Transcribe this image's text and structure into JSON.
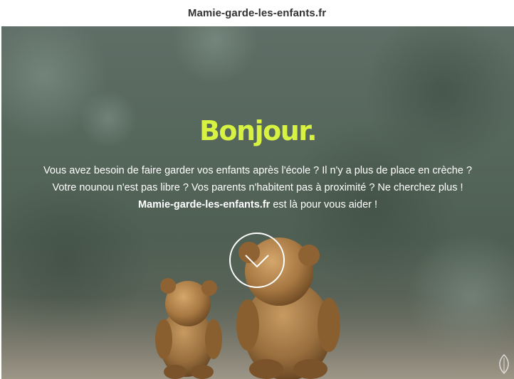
{
  "header": {
    "site_title": "Mamie-garde-les-enfants.fr"
  },
  "hero": {
    "greeting": "Bonjour.",
    "line1": "Vous avez besoin de faire garder vos enfants après l'école ? Il n'y a plus de place en crèche ?",
    "line2": "Votre nounou n'est pas libre ? Vos parents n'habitent pas à proximité ? Ne cherchez plus !",
    "line3_brand": "Mamie-garde-les-enfants.fr",
    "line3_rest": " est là pour vous aider !",
    "scroll_icon": "chevron-down-icon",
    "corner_icon": "leaf-icon"
  },
  "colors": {
    "accent": "#d7f241",
    "text_light": "#ffffff",
    "header_text": "#333333"
  }
}
